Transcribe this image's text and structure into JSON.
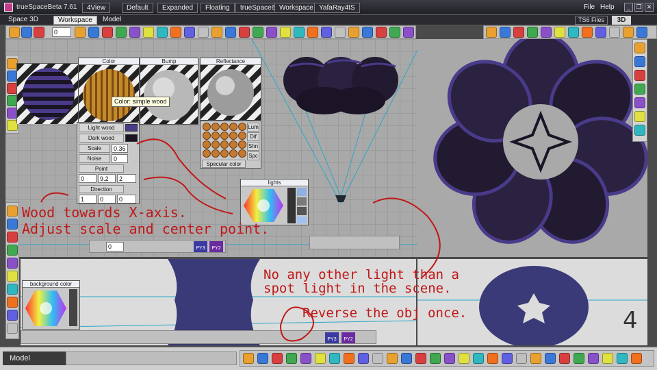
{
  "app_title": "trueSpaceBeta 7.61",
  "menu_tabs": [
    "4View",
    "Default",
    "Expanded",
    "Floating",
    "trueSpace6",
    "Workspace",
    "YafaRay4tS"
  ],
  "menu_right": {
    "file": "File",
    "help": "Help"
  },
  "window_controls": {
    "minimize": "_",
    "restore": "❐",
    "close": "✕"
  },
  "view_tabs": {
    "space3d": "Space 3D",
    "workspace": "Workspace",
    "model": "Model"
  },
  "ts6_files": "TS6 Files",
  "view_badge": "3D",
  "toolbar_number": "0",
  "material_panels": {
    "color": "Color",
    "bump": "Bump",
    "reflectance": "Reflectance",
    "tooltip": "Color: simple wood"
  },
  "wood_params": {
    "light_wood": "Light wood",
    "dark_wood": "Dark wood",
    "scale_label": "Scale",
    "scale_value": "0.36",
    "noise_label": "Noise",
    "noise_value": "0",
    "point_label": "Point",
    "point_values": [
      "0",
      "9.2",
      "2"
    ],
    "direction_label": "Direction",
    "direction_values": [
      "1",
      "0",
      "0"
    ]
  },
  "reflect_buttons": [
    "Lum",
    "Dif",
    "Shn",
    "Spc"
  ],
  "specular_color": "Specular color",
  "lights_panel": {
    "title": "lights"
  },
  "background_panel": {
    "title": "background color"
  },
  "anim_number": "0",
  "plugin_labels": [
    "PY3",
    "PY2"
  ],
  "view_number": "4",
  "annotations": [
    "Wood towards X-axis.",
    "Adjust scale and center point.",
    "No any other light than a",
    "spot light in the scene.",
    "Reverse the obj once."
  ],
  "status": {
    "mode": "Model"
  },
  "colors": {
    "annotation": "#c01818",
    "object_dark": "#221a30",
    "object_stripe": "#4a3a8a",
    "grid_bg": "#a9a9a9",
    "bottom_bg": "#dcdcdc"
  }
}
